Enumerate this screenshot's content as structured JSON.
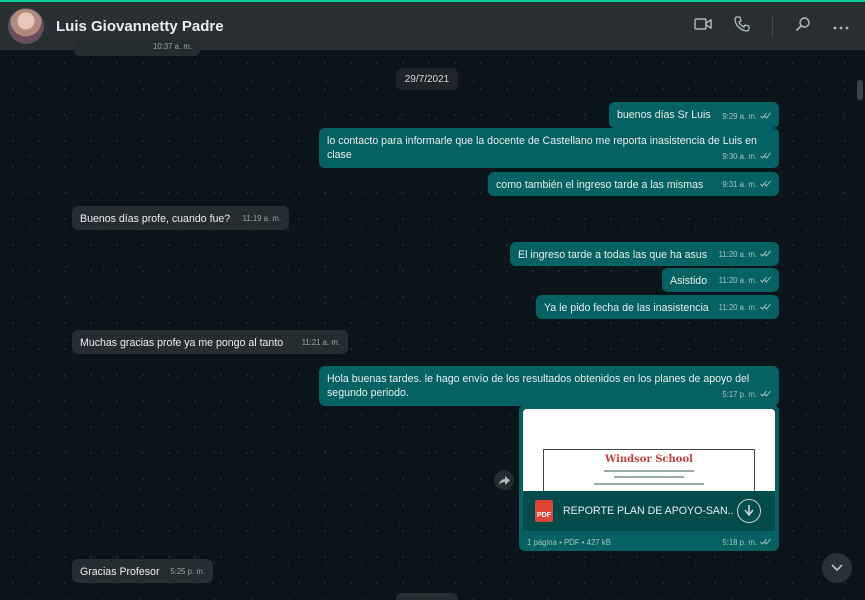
{
  "header": {
    "contact_name": "Luis Giovannetty Padre",
    "icons": [
      "video-icon",
      "phone-icon",
      "search-icon",
      "menu-icon"
    ]
  },
  "partial_top": {
    "time": "10:37 a. m."
  },
  "date_chip": "29/7/2021",
  "messages": [
    {
      "dir": "out",
      "text": "buenos días Sr Luis",
      "time": "9:29 a. m."
    },
    {
      "dir": "out",
      "text": "lo contacto para informarle que la docente de Castellano me reporta inasistencia de Luis en clase",
      "time": "9:30 a. m."
    },
    {
      "dir": "out",
      "text": "como también el ingreso tarde a las mismas",
      "time": "9:31 a. m."
    },
    {
      "dir": "in",
      "text": "Buenos días profe, cuando fue?",
      "time": "11:19 a. m."
    },
    {
      "dir": "out",
      "text": "El ingreso tarde a todas las que ha asus",
      "time": "11:20 a. m."
    },
    {
      "dir": "out",
      "text": "Asistido",
      "time": "11:20 a. m."
    },
    {
      "dir": "out",
      "text": "Ya le pido fecha de las inasistencia",
      "time": "11:20 a. m."
    },
    {
      "dir": "in",
      "text": "Muchas gracias profe ya me pongo al tanto",
      "time": "11:21 a. m."
    },
    {
      "dir": "out",
      "text": "Hola buenas tardes. le hago envío de los resultados obtenidos en los planes de apoyo del segundo periodo.",
      "time": "5:17 p. m."
    },
    {
      "dir": "in",
      "text": "Gracias Profesor",
      "time": "5:25 p. m."
    }
  ],
  "document": {
    "school": "Windsor School",
    "file_type_badge": "PDF",
    "file_name": "REPORTE PLAN DE APOYO-SAN...",
    "file_info": "1 página • PDF • 427 kB",
    "time": "5:18 p. m."
  },
  "colors": {
    "outgoing": "#056162",
    "incoming": "#262d31",
    "header": "#2a2f32",
    "accent": "#06cf9c"
  }
}
